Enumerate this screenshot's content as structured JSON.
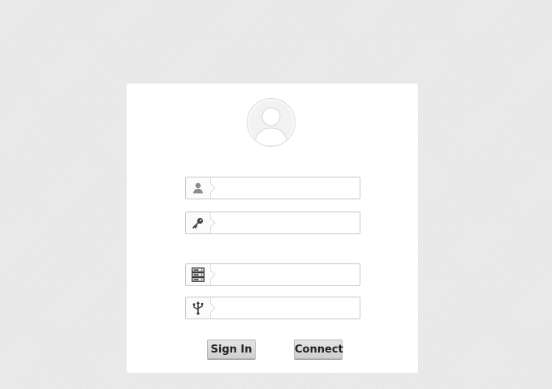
{
  "login_form": {
    "username": {
      "icon": "user-icon",
      "value": "",
      "placeholder": ""
    },
    "password": {
      "icon": "key-icon",
      "value": "",
      "placeholder": ""
    },
    "server": {
      "icon": "server-icon",
      "value": "",
      "placeholder": ""
    },
    "port": {
      "icon": "usb-icon",
      "value": "",
      "placeholder": ""
    },
    "signin_label": "Sign In",
    "connect_label": "Connect"
  },
  "colors": {
    "background": "#e9e9e9",
    "card": "#ffffff",
    "button": "#d8d8d8",
    "icon": "#555555"
  }
}
